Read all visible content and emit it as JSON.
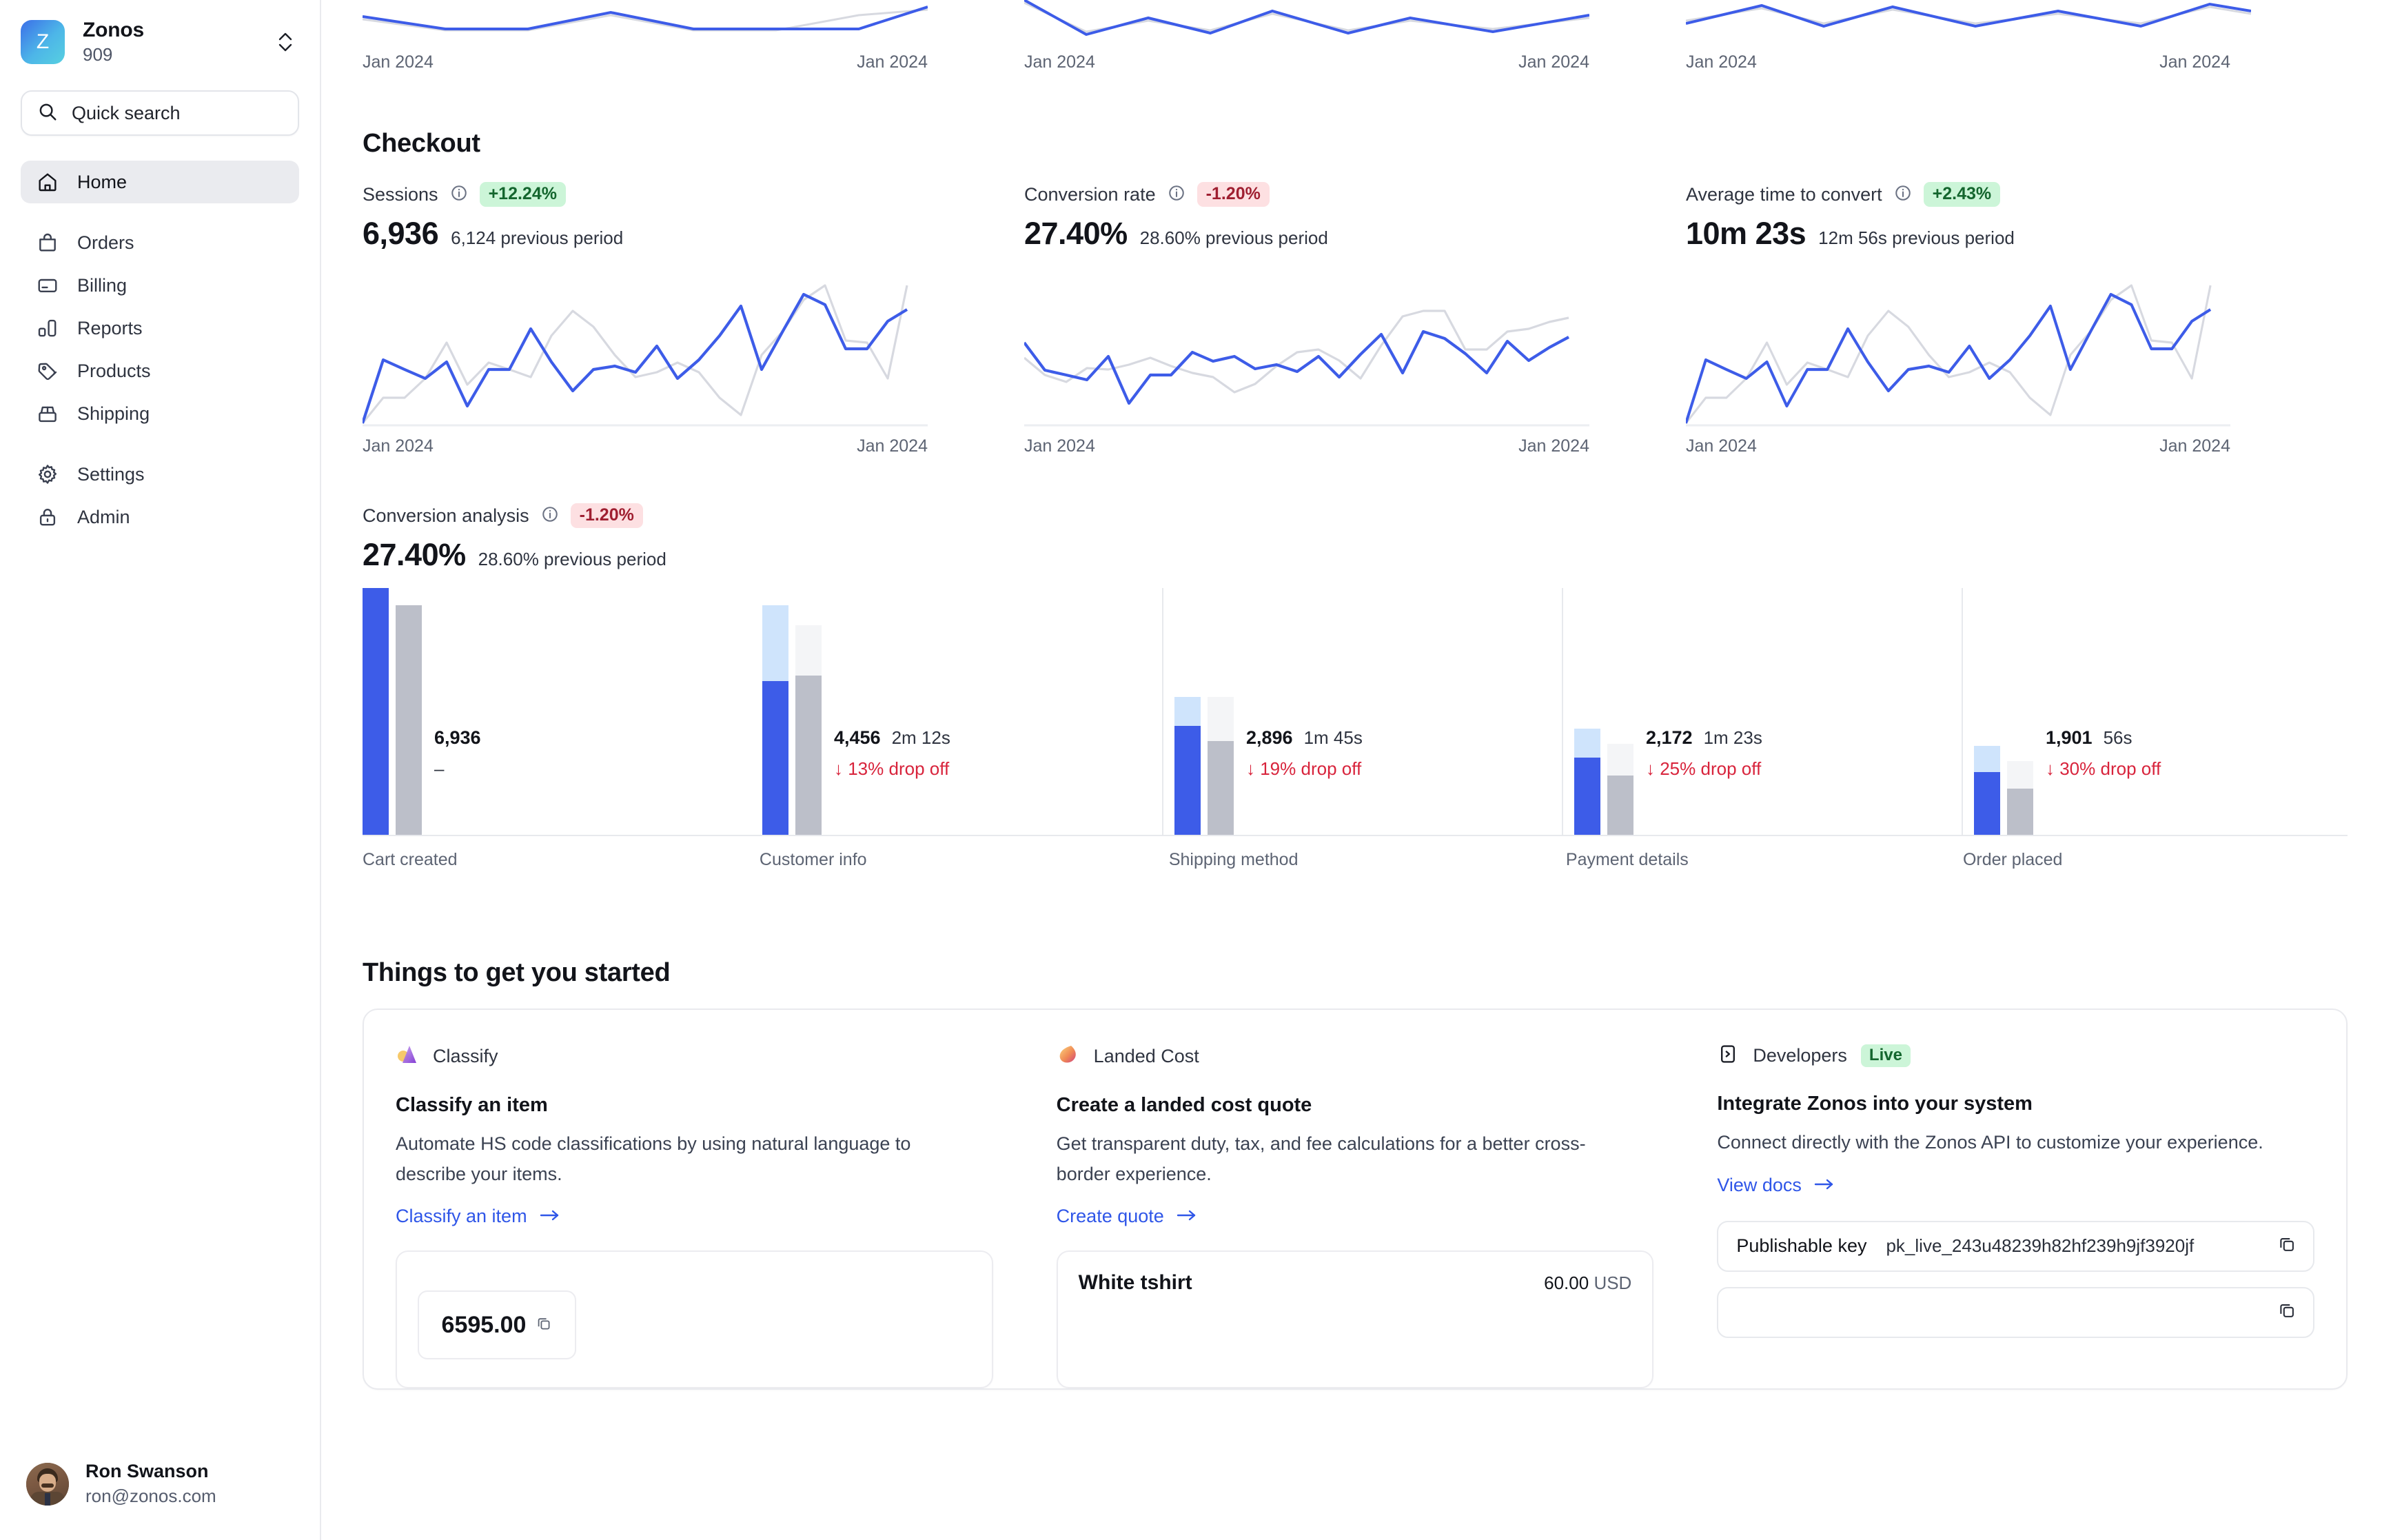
{
  "sidebar": {
    "org": {
      "name": "Zonos",
      "id": "909",
      "logo_letter": "Z",
      "chevron_icon": "chevron-updown-icon"
    },
    "search": {
      "placeholder": "Quick search",
      "icon": "search-icon"
    },
    "items": [
      {
        "label": "Home",
        "icon": "home-icon",
        "active": true
      },
      {
        "label": "Orders",
        "icon": "bag-icon",
        "active": false
      },
      {
        "label": "Billing",
        "icon": "credit-card-icon",
        "active": false
      },
      {
        "label": "Reports",
        "icon": "bar-chart-icon",
        "active": false
      },
      {
        "label": "Products",
        "icon": "tag-icon",
        "active": false
      },
      {
        "label": "Shipping",
        "icon": "box-icon",
        "active": false
      },
      {
        "label": "Settings",
        "icon": "gear-icon",
        "active": false
      },
      {
        "label": "Admin",
        "icon": "lock-icon",
        "active": false
      }
    ],
    "user": {
      "name": "Ron Swanson",
      "email": "ron@zonos.com"
    }
  },
  "top_sparklines": {
    "axis_start": "Jan 2024",
    "axis_end": "Jan 2024"
  },
  "checkout": {
    "title": "Checkout",
    "metrics": [
      {
        "label": "Sessions",
        "info_icon": "info-icon",
        "badge": "+12.24%",
        "badge_dir": "up",
        "value": "6,936",
        "previous": "6,124 previous period",
        "axis_start": "Jan 2024",
        "axis_end": "Jan 2024"
      },
      {
        "label": "Conversion rate",
        "info_icon": "info-icon",
        "badge": "-1.20%",
        "badge_dir": "down",
        "value": "27.40%",
        "previous": "28.60% previous period",
        "axis_start": "Jan 2024",
        "axis_end": "Jan 2024"
      },
      {
        "label": "Average time to convert",
        "info_icon": "info-icon",
        "badge": "+2.43%",
        "badge_dir": "up",
        "value": "10m 23s",
        "previous": "12m 56s previous period",
        "axis_start": "Jan 2024",
        "axis_end": "Jan 2024"
      }
    ]
  },
  "conversion_analysis": {
    "label": "Conversion analysis",
    "info_icon": "info-icon",
    "badge": "-1.20%",
    "badge_dir": "down",
    "value": "27.40%",
    "previous": "28.60% previous period"
  },
  "chart_data": [
    {
      "type": "line",
      "title": "Sessions",
      "xlabel": "",
      "ylabel": "",
      "x_tick_labels": [
        "Jan 2024",
        "Jan 2024"
      ],
      "grid": false,
      "legend": "none",
      "series": [
        {
          "name": "Current period",
          "color": "#3d5ce8",
          "values": [
            2,
            38,
            32,
            28,
            37,
            10,
            32,
            32,
            57,
            37,
            23,
            32,
            35,
            33,
            49,
            30,
            38,
            52,
            76,
            32,
            55,
            85,
            72,
            46,
            46,
            66,
            73
          ]
        },
        {
          "name": "Previous period",
          "color": "#d7d9e0",
          "values": [
            2,
            33,
            33,
            44,
            63,
            37,
            52,
            48,
            44,
            69,
            82,
            72,
            56,
            44,
            47,
            52,
            47,
            33,
            14,
            55,
            70,
            88,
            95,
            63,
            62,
            46,
            95
          ]
        }
      ]
    },
    {
      "type": "line",
      "title": "Conversion rate",
      "xlabel": "",
      "ylabel": "",
      "x_tick_labels": [
        "Jan 2024",
        "Jan 2024"
      ],
      "grid": false,
      "legend": "none",
      "series": [
        {
          "name": "Current period",
          "color": "#3d5ce8",
          "values": [
            48,
            30,
            28,
            25,
            41,
            10,
            28,
            28,
            43,
            37,
            42,
            33,
            36,
            32,
            41,
            30,
            43,
            58,
            30,
            60,
            53,
            44,
            32,
            50,
            38,
            46,
            52
          ]
        },
        {
          "name": "Previous period",
          "color": "#d7d9e0",
          "values": [
            43,
            32,
            28,
            36,
            35,
            38,
            43,
            37,
            33,
            30,
            20,
            26,
            38,
            46,
            48,
            40,
            27,
            50,
            69,
            72,
            72,
            48,
            48,
            60,
            62,
            66,
            68
          ]
        }
      ]
    },
    {
      "type": "line",
      "title": "Average time to convert",
      "xlabel": "",
      "ylabel": "",
      "x_tick_labels": [
        "Jan 2024",
        "Jan 2024"
      ],
      "grid": false,
      "legend": "none",
      "series": [
        {
          "name": "Current period",
          "color": "#3d5ce8",
          "values": [
            2,
            38,
            32,
            28,
            37,
            10,
            32,
            32,
            57,
            37,
            23,
            32,
            35,
            33,
            49,
            30,
            38,
            52,
            76,
            32,
            55,
            85,
            72,
            46,
            46,
            66,
            73
          ]
        },
        {
          "name": "Previous period",
          "color": "#d7d9e0",
          "values": [
            2,
            33,
            33,
            44,
            63,
            37,
            52,
            48,
            44,
            69,
            82,
            72,
            56,
            44,
            47,
            52,
            47,
            33,
            14,
            55,
            70,
            88,
            95,
            63,
            62,
            46,
            95
          ]
        }
      ]
    },
    {
      "type": "bar",
      "title": "Conversion analysis",
      "subtitle": "27.40% vs 28.60% previous period",
      "xlabel": "",
      "ylabel": "",
      "grid": false,
      "legend": "none",
      "categories": [
        "Cart created",
        "Customer info",
        "Shipping method",
        "Payment details",
        "Order placed"
      ],
      "series": [
        {
          "name": "Current period",
          "color": "#3d5ce8",
          "values": [
            6936,
            4456,
            2896,
            2172,
            1901
          ]
        },
        {
          "name": "Previous period",
          "color": "#bcbfc9",
          "values": [
            6936,
            4456,
            2896,
            2172,
            1901
          ]
        }
      ],
      "steps": [
        {
          "label": "Cart created",
          "count": "6,936",
          "time": "",
          "drop": "",
          "dash": "–",
          "cur_total_pct": 100,
          "cur_fill_pct": 100,
          "prev_total_pct": 93,
          "prev_fill_pct": 100
        },
        {
          "label": "Customer info",
          "count": "4,456",
          "time": "2m 12s",
          "drop": "↓  13% drop off",
          "dash": "",
          "cur_total_pct": 93,
          "cur_fill_pct": 67,
          "prev_total_pct": 85,
          "prev_fill_pct": 76
        },
        {
          "label": "Shipping method",
          "count": "2,896",
          "time": "1m 45s",
          "drop": "↓  19% drop off",
          "dash": "",
          "cur_total_pct": 56,
          "cur_fill_pct": 79,
          "prev_total_pct": 56,
          "prev_fill_pct": 68
        },
        {
          "label": "Payment details",
          "count": "2,172",
          "time": "1m 23s",
          "drop": "↓  25% drop off",
          "dash": "",
          "cur_total_pct": 43,
          "cur_fill_pct": 73,
          "prev_total_pct": 37,
          "prev_fill_pct": 65
        },
        {
          "label": "Order placed",
          "count": "1,901",
          "time": "56s",
          "drop": "↓  30% drop off",
          "dash": "",
          "cur_total_pct": 36,
          "cur_fill_pct": 71,
          "prev_total_pct": 30,
          "prev_fill_pct": 62
        }
      ]
    }
  ],
  "getting_started": {
    "title": "Things to get you started",
    "cards": [
      {
        "product": "Classify",
        "product_icon": "classify-icon",
        "heading": "Classify an item",
        "body": "Automate HS code classifications by using natural language to describe your items.",
        "link": "Classify an item",
        "link_icon": "arrow-right-icon",
        "mini_amount": "6595.00",
        "mini_icon": "copy-icon"
      },
      {
        "product": "Landed Cost",
        "product_icon": "landed-cost-icon",
        "heading": "Create a landed cost quote",
        "body": "Get transparent duty, tax, and fee calculations for a better cross-border experience.",
        "link": "Create quote",
        "link_icon": "arrow-right-icon",
        "item_name": "White tshirt",
        "item_price": "60.00",
        "item_currency": "USD"
      },
      {
        "product": "Developers",
        "product_icon": "terminal-icon",
        "badge": "Live",
        "heading": "Integrate Zonos into your system",
        "body": "Connect directly with the Zonos API to customize your experience.",
        "link": "View docs",
        "link_icon": "arrow-right-icon",
        "keys": [
          {
            "label": "Publishable key",
            "value": "pk_live_243u48239h82hf239h9jf3920jf",
            "copy_icon": "copy-icon"
          },
          {
            "label": "",
            "value": "",
            "copy_icon": "copy-icon"
          }
        ]
      }
    ]
  },
  "colors": {
    "accent_blue": "#3d5ce8",
    "light_blue": "#cfe4fc",
    "prev_gray": "#bcbfc9",
    "prev_light": "#f4f5f7",
    "success_bg": "#ccf5d8",
    "success_fg": "#14662e",
    "danger_bg": "#fde0e2",
    "danger_fg": "#9f1f31",
    "drop_red": "#d8243c"
  }
}
